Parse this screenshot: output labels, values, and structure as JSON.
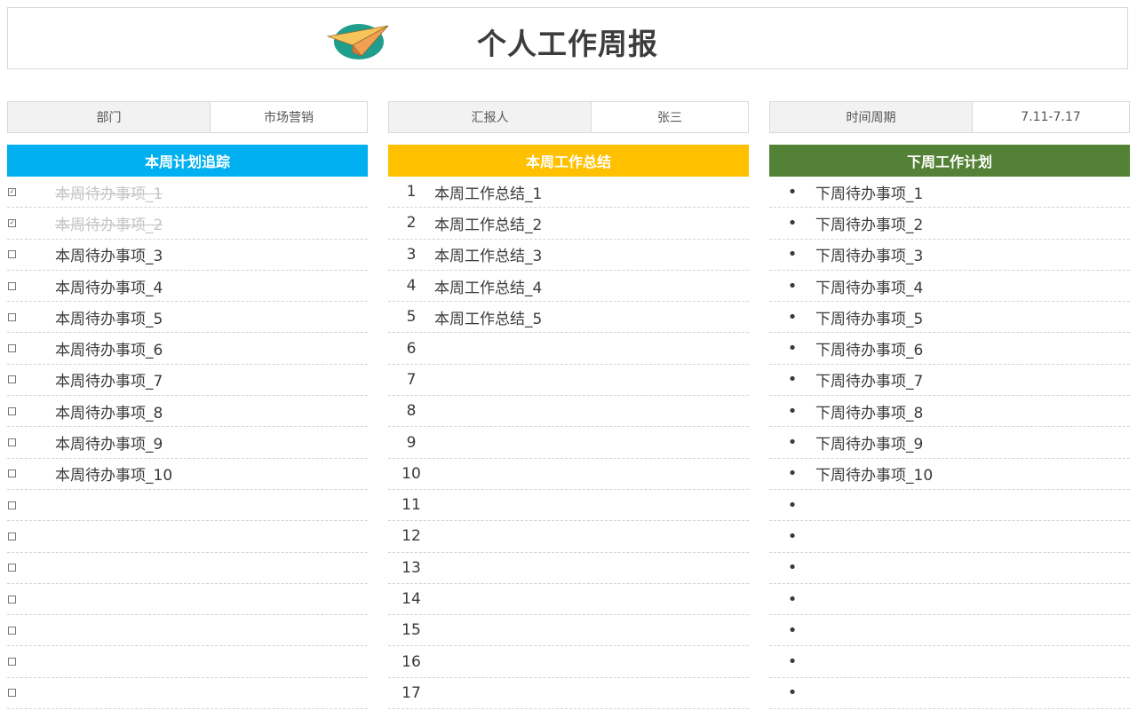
{
  "header": {
    "title": "个人工作周报",
    "logo_icon": "paper-plane-icon"
  },
  "colors": {
    "blue": "#00b0f0",
    "orange": "#ffc000",
    "green": "#538135"
  },
  "columns": [
    {
      "info_label": "部门",
      "info_value": "市场营销",
      "heading": "本周计划追踪",
      "color": "#00b0f0",
      "kind": "check",
      "rows": [
        {
          "text": "本周待办事项_1",
          "done": true
        },
        {
          "text": "本周待办事项_2",
          "done": true
        },
        {
          "text": "本周待办事项_3",
          "done": false
        },
        {
          "text": "本周待办事项_4",
          "done": false
        },
        {
          "text": "本周待办事项_5",
          "done": false
        },
        {
          "text": "本周待办事项_6",
          "done": false
        },
        {
          "text": "本周待办事项_7",
          "done": false
        },
        {
          "text": "本周待办事项_8",
          "done": false
        },
        {
          "text": "本周待办事项_9",
          "done": false
        },
        {
          "text": "本周待办事项_10",
          "done": false
        },
        {
          "text": "",
          "done": false
        },
        {
          "text": "",
          "done": false
        },
        {
          "text": "",
          "done": false
        },
        {
          "text": "",
          "done": false
        },
        {
          "text": "",
          "done": false
        },
        {
          "text": "",
          "done": false
        },
        {
          "text": "",
          "done": false
        }
      ]
    },
    {
      "info_label": "汇报人",
      "info_value": "张三",
      "heading": "本周工作总结",
      "color": "#ffc000",
      "kind": "number",
      "rows": [
        {
          "marker": "1",
          "text": "本周工作总结_1"
        },
        {
          "marker": "2",
          "text": "本周工作总结_2"
        },
        {
          "marker": "3",
          "text": "本周工作总结_3"
        },
        {
          "marker": "4",
          "text": "本周工作总结_4"
        },
        {
          "marker": "5",
          "text": "本周工作总结_5"
        },
        {
          "marker": "6",
          "text": ""
        },
        {
          "marker": "7",
          "text": ""
        },
        {
          "marker": "8",
          "text": ""
        },
        {
          "marker": "9",
          "text": ""
        },
        {
          "marker": "10",
          "text": ""
        },
        {
          "marker": "11",
          "text": ""
        },
        {
          "marker": "12",
          "text": ""
        },
        {
          "marker": "13",
          "text": ""
        },
        {
          "marker": "14",
          "text": ""
        },
        {
          "marker": "15",
          "text": ""
        },
        {
          "marker": "16",
          "text": ""
        },
        {
          "marker": "17",
          "text": ""
        }
      ]
    },
    {
      "info_label": "时间周期",
      "info_value": "7.11-7.17",
      "heading": "下周工作计划",
      "color": "#538135",
      "kind": "bullet",
      "rows": [
        {
          "marker": "•",
          "text": "下周待办事项_1"
        },
        {
          "marker": "•",
          "text": "下周待办事项_2"
        },
        {
          "marker": "•",
          "text": "下周待办事项_3"
        },
        {
          "marker": "•",
          "text": "下周待办事项_4"
        },
        {
          "marker": "•",
          "text": "下周待办事项_5"
        },
        {
          "marker": "•",
          "text": "下周待办事项_6"
        },
        {
          "marker": "•",
          "text": "下周待办事项_7"
        },
        {
          "marker": "•",
          "text": "下周待办事项_8"
        },
        {
          "marker": "•",
          "text": "下周待办事项_9"
        },
        {
          "marker": "•",
          "text": "下周待办事项_10"
        },
        {
          "marker": "•",
          "text": ""
        },
        {
          "marker": "•",
          "text": ""
        },
        {
          "marker": "•",
          "text": ""
        },
        {
          "marker": "•",
          "text": ""
        },
        {
          "marker": "•",
          "text": ""
        },
        {
          "marker": "•",
          "text": ""
        },
        {
          "marker": "•",
          "text": ""
        }
      ]
    }
  ]
}
